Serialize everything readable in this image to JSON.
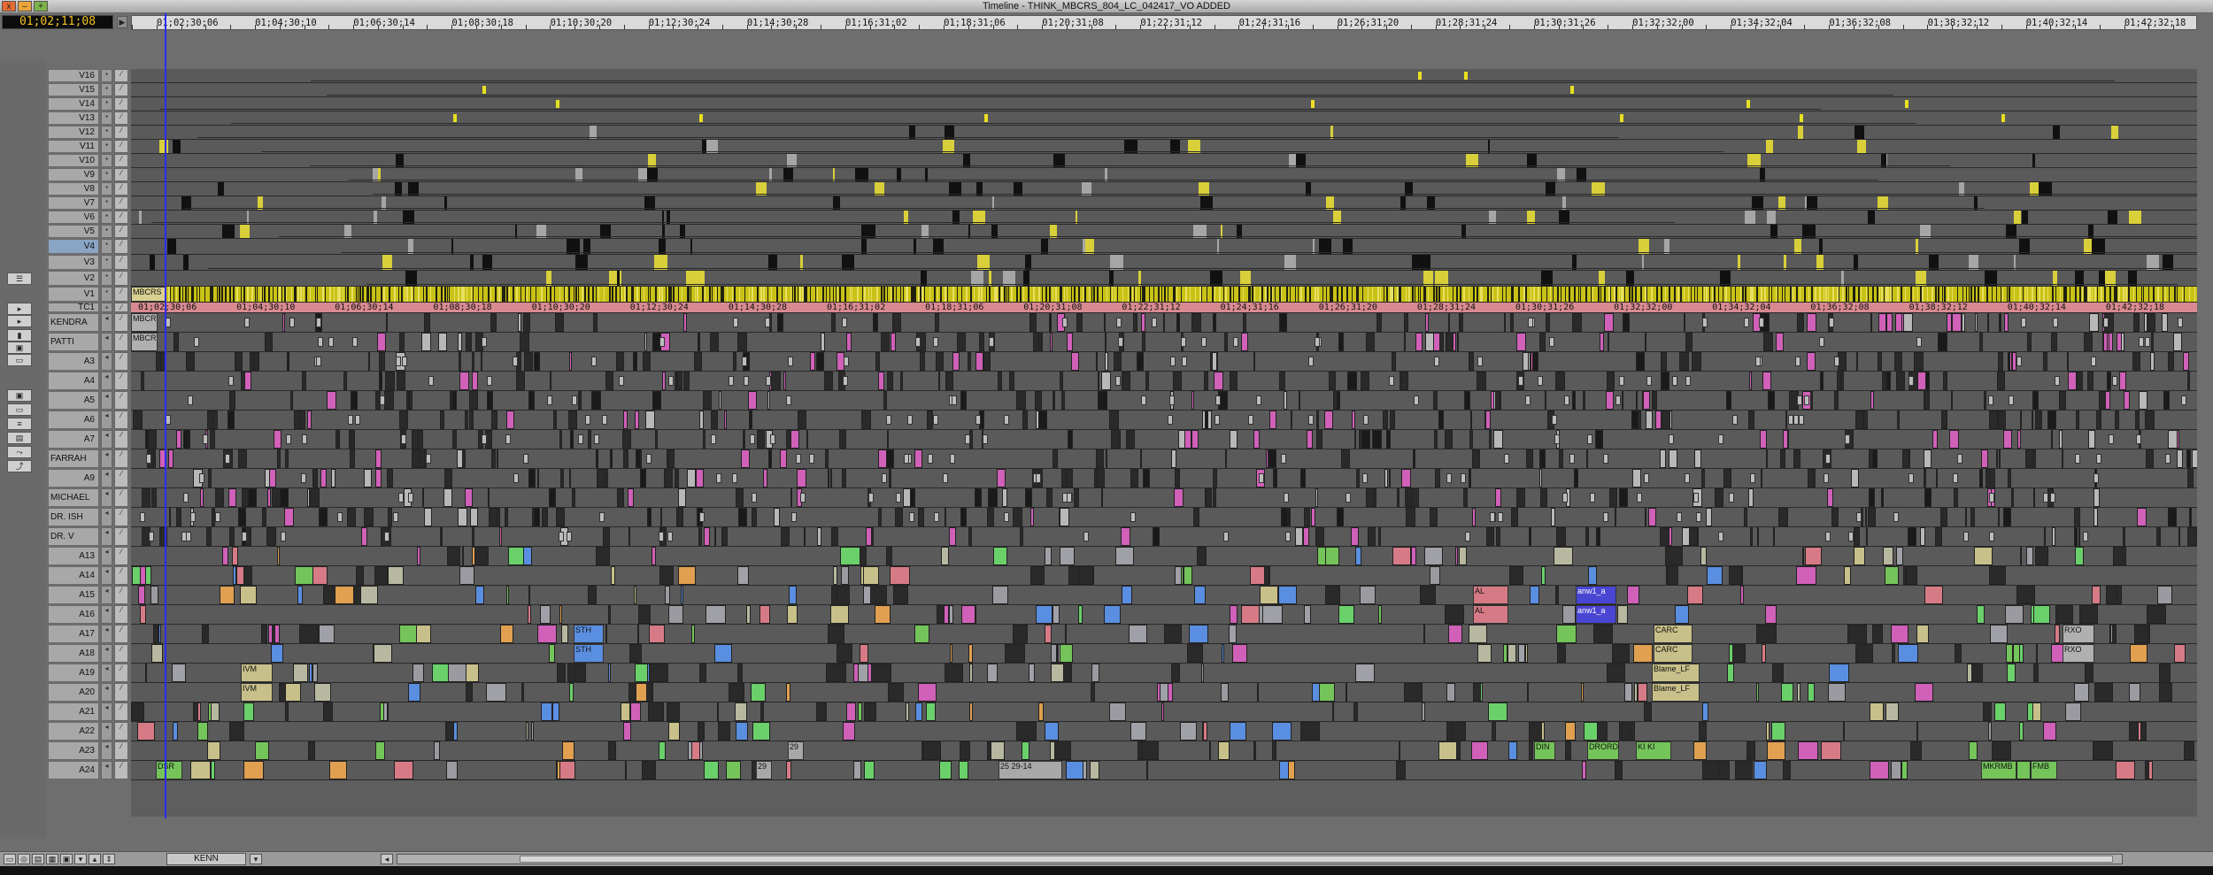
{
  "window": {
    "title": "Timeline - THINK_MBCRS_804_LC_042417_VO ADDED",
    "close": "x",
    "minimize": "–",
    "zoom": "+"
  },
  "timecode": "01;02;11;08",
  "ruler": {
    "labels": [
      "01;02;30;06",
      "01;04;30;10",
      "01;06;30;14",
      "01;08;30;18",
      "01;10;30;20",
      "01;12;30;24",
      "01;14;30;28",
      "01;16;31;02",
      "01;18;31;06",
      "01;20;31;08",
      "01;22;31;12",
      "01;24;31;16",
      "01;26;31;20",
      "01;28;31;24",
      "01;30;31;26",
      "01;32;32;00",
      "01;34;32;04",
      "01;36;32;08",
      "01;38;32;12",
      "01;40;32;14",
      "01;42;32;18"
    ]
  },
  "tc_track": {
    "labels": [
      "01;02;30;06",
      "01;04;30;10",
      "01;06;30;14",
      "01;08;30;18",
      "01;10;30;20",
      "01;12;30;24",
      "01;14;30;28",
      "01;16;31;02",
      "01;18;31;06",
      "01;20;31;08",
      "01;22;31;12",
      "01;24;31;16",
      "01;26;31;20",
      "01;28;31;24",
      "01;30;31;26",
      "01;32;32;00",
      "01;34;32;04",
      "01;36;32;08",
      "01;38;32;12",
      "01;40;32;14",
      "01;42;32;18"
    ]
  },
  "tracks": {
    "video": [
      "V16",
      "V15",
      "V14",
      "V13",
      "V12",
      "V11",
      "V10",
      "V9",
      "V8",
      "V7",
      "V6",
      "V5",
      "V4",
      "V3",
      "V2",
      "V1"
    ],
    "tc": "TC1",
    "audio": [
      "KENDRA",
      "PATTI",
      "A3",
      "A4",
      "A5",
      "A6",
      "A7",
      "FARRAH",
      "A9",
      "MICHAEL",
      "DR. ISH",
      "DR. V",
      "A13",
      "A14",
      "A15",
      "A16",
      "A17",
      "A18",
      "A19",
      "A20",
      "A21",
      "A22",
      "A23",
      "A24"
    ],
    "selected": "V4"
  },
  "clip_labels": {
    "v1_first": "MBCRS",
    "kendra_first": "MBCRS",
    "patti_first": "MBCRS",
    "a15_anw": "anw1_a",
    "a16_anw": "anw1_a",
    "a15_al": "AL",
    "a16_al": "AL",
    "a17_carc": "CARC",
    "a18_carc": "CARC",
    "a19_blame": "Blame_LF",
    "a20_blame": "Blame_LF",
    "a19_ivm": "IVM",
    "a20_ivm": "IVM",
    "a23_din": "DIN",
    "a23_dr": "DRORD",
    "a23_ki": "KI KI",
    "a23_29": "29",
    "a24_29": "29",
    "a24_2529": "25 29-14",
    "a24_mk": "MKRMB",
    "a24_fm": "FMB",
    "a24_dsr": "DSR",
    "a17_sth": "STH",
    "a18_sth": "STH",
    "a17_rx": "RXO",
    "a18_rx": "RXO"
  },
  "bottom": {
    "user": "KENN"
  },
  "colors": {
    "tc_track": "#d88a90",
    "v1_clip": "#c9c216",
    "audio_green": "#74c45a",
    "audio_magenta": "#d060b8",
    "audio_pink": "#d67b86",
    "audio_beige": "#c8c08a",
    "audio_blue": "#5a8ee0",
    "audio_indigo": "#4a46d4",
    "audio_gray": "#9a9aa0",
    "playhead": "#2c2cff",
    "timecode_text": "#f0c020"
  }
}
